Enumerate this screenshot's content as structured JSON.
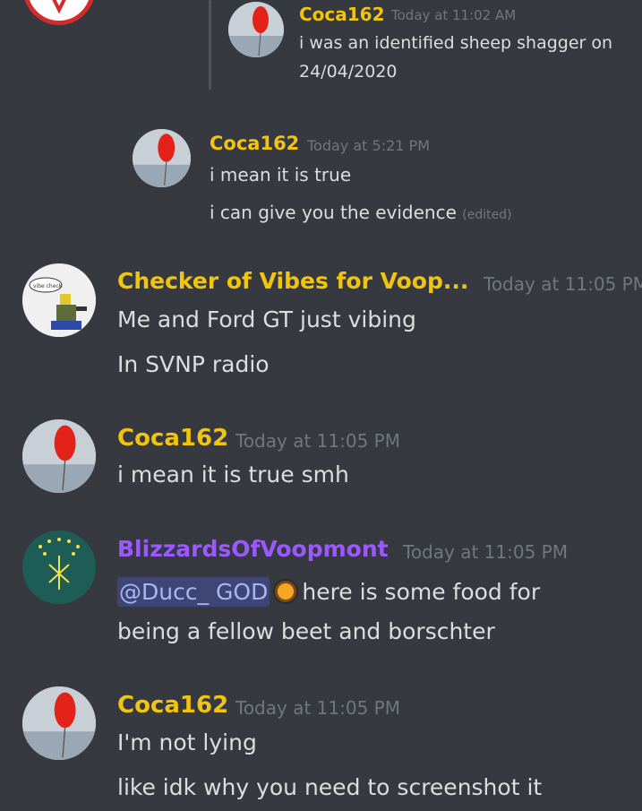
{
  "messages": [
    {
      "author": "Coca162",
      "time": "Today at 11:02 AM",
      "lines": [
        "i was an identified sheep shagger on",
        "24/04/2020"
      ]
    },
    {
      "author": "Coca162",
      "time": "Today at 5:21 PM",
      "lines": [
        "i mean it is true",
        "i can give you the evidence"
      ],
      "edited": "(edited)"
    },
    {
      "author": "Checker of Vibes for Voop...",
      "time": "Today at 11:05 PM",
      "avatar_caption": "vibe check",
      "lines": [
        "Me and Ford GT just vibing",
        "In SVNP radio"
      ]
    },
    {
      "author": "Coca162",
      "time": "Today at 11:05 PM",
      "lines": [
        "i mean it is true smh"
      ]
    },
    {
      "author": "BlizzardsOfVoopmont",
      "time": "Today at 11:05 PM",
      "mention": "@Ducc_ GOD",
      "lines": [
        "here is some food for",
        "being a fellow beet and borschter"
      ]
    },
    {
      "author": "Coca162",
      "time": "Today at 11:05 PM",
      "lines": [
        "I'm not lying",
        "like idk why you need to screenshot it"
      ]
    }
  ],
  "colors": {
    "background": "#36393f",
    "name_yellow": "#f1c40f",
    "name_purple": "#9b59ff",
    "timestamp": "#72767d",
    "mention_bg": "#3e4676"
  },
  "icons": [
    "logo-avatar-icon",
    "balloon-avatar-icon",
    "vibe-check-avatar-icon",
    "flag-avatar-icon",
    "food-emoji-icon"
  ]
}
